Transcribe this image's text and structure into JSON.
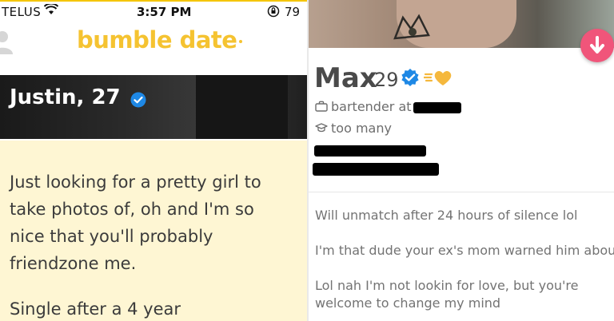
{
  "status_bar": {
    "carrier": "TELUS",
    "time": "3:57 PM",
    "battery": "79"
  },
  "left_profile": {
    "app_logo": "bumble date",
    "name_age": "Justin, 27",
    "bio_lines": "Just looking for a pretty girl to\ntake photos of, oh and I'm so\nnice that you'll probably\nfriendzone me.",
    "bio_cut": "Single after a 4 year",
    "accent_color": "#f5c331",
    "verified_color": "#1e88e5"
  },
  "right_profile": {
    "name": "Max",
    "age": "29",
    "job": "bartender at",
    "school": "too many",
    "bio_line_1": "Will unmatch after 24 hours of silence lol",
    "bio_line_2": "I'm that dude your ex's mom warned him about.",
    "bio_line_3a": "Lol nah I'm not lookin for love, but you're",
    "bio_line_3b": "welcome to change my mind",
    "action_color": "#f0557a",
    "verified_color": "#1e88e5",
    "super_like_color": "#f5b83d"
  },
  "icons": [
    "wifi-icon",
    "lock-rotation-icon",
    "profile-icon",
    "verified-badge-icon",
    "briefcase-icon",
    "graduation-cap-icon",
    "arrow-down-icon",
    "gold-heart-icon"
  ]
}
